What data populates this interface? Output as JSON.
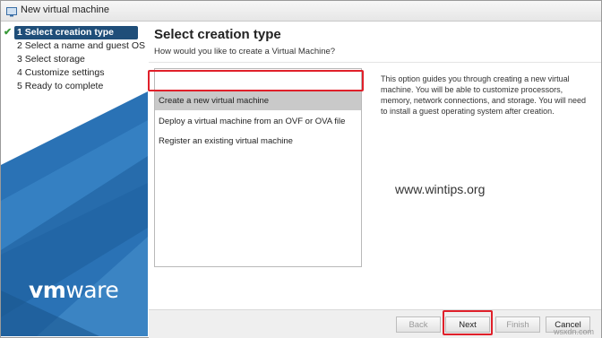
{
  "window": {
    "title": "New virtual machine"
  },
  "steps": [
    {
      "label": "1 Select creation type",
      "completed": true,
      "active": true
    },
    {
      "label": "2 Select a name and guest OS"
    },
    {
      "label": "3 Select storage"
    },
    {
      "label": "4 Customize settings"
    },
    {
      "label": "5 Ready to complete"
    }
  ],
  "brand": {
    "logo_bold": "vm",
    "logo_rest": "ware"
  },
  "main": {
    "title": "Select creation type",
    "subtitle": "How would you like to create a Virtual Machine?",
    "options": [
      {
        "label": "Create a new virtual machine",
        "selected": true
      },
      {
        "label": "Deploy a virtual machine from an OVF or OVA file"
      },
      {
        "label": "Register an existing virtual machine"
      }
    ],
    "description": "This option guides you through creating a new virtual machine. You will be able to customize processors, memory, network connections, and storage. You will need to install a guest operating system after creation."
  },
  "watermark": {
    "center": "www.wintips.org",
    "corner": "wsxdn.com"
  },
  "buttons": {
    "back": "Back",
    "next": "Next",
    "finish": "Finish",
    "cancel": "Cancel"
  },
  "colors": {
    "sidebar_blue": "#1f6fb8",
    "active_step": "#1f4e79",
    "highlight_red": "#e0202a"
  }
}
